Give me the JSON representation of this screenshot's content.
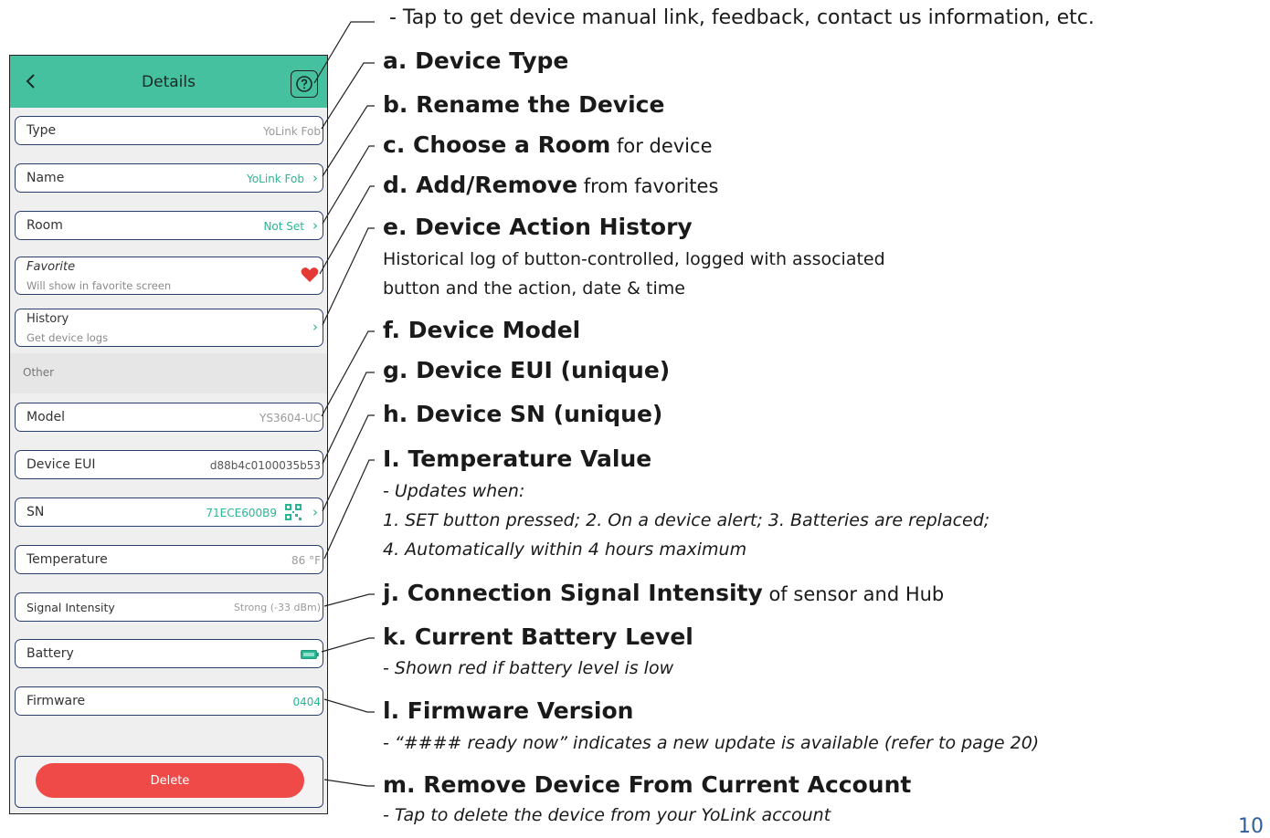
{
  "app": {
    "header_title": "Details",
    "header_color": "#45c1a0",
    "back_icon": "chevron-left-icon",
    "help_icon": "question-circle-icon",
    "rows": {
      "type": {
        "label": "Type",
        "value": "YoLink Fob"
      },
      "name": {
        "label": "Name",
        "value": "YoLink Fob"
      },
      "room": {
        "label": "Room",
        "value": "Not Set"
      },
      "favorite": {
        "label": "Favorite",
        "sub": "Will show in favorite screen"
      },
      "history": {
        "label": "History",
        "sub": "Get device logs"
      },
      "model": {
        "label": "Model",
        "value": "YS3604-UC"
      },
      "eui": {
        "label": "Device EUI",
        "value": "d88b4c0100035b53"
      },
      "sn": {
        "label": "SN",
        "value": "71ECE600B9"
      },
      "temperature": {
        "label": "Temperature",
        "value": "86 °F"
      },
      "signal": {
        "label": "Signal Intensity",
        "value": "Strong (-33 dBm)"
      },
      "battery": {
        "label": "Battery"
      },
      "firmware": {
        "label": "Firmware",
        "value": "0404"
      }
    },
    "section_other": "Other",
    "delete_label": "Delete",
    "accent_color": "#2bb594",
    "delete_color": "#ef4a48",
    "favorite_color": "#e53935"
  },
  "annotations": {
    "help": "- Tap to get device manual link, feedback, contact us information, etc.",
    "a": "a. Device Type",
    "b": "b. Rename the Device",
    "c_bold": "c. Choose a Room",
    "c_rest": " for device",
    "d_bold": "d. Add/Remove",
    "d_rest": " from favorites",
    "e": "e. Device Action History",
    "e_line1": "Historical log of button-controlled, logged with associated",
    "e_line2": "button and the action, date & time",
    "f": "f. Device Model",
    "g": "g. Device EUI (unique)",
    "h": "h. Device SN (unique)",
    "i": "I. Temperature Value",
    "i_line1": "- Updates when:",
    "i_line2": "1. SET button pressed; 2. On a device alert; 3. Batteries are replaced;",
    "i_line3": "4. Automatically within 4 hours maximum",
    "j_bold": "j. Connection Signal Intensity",
    "j_rest": " of sensor and Hub",
    "k": "k. Current Battery Level",
    "k_line1": "- Shown red if battery level is low",
    "l": "l. Firmware Version",
    "l_line1": "- “#### ready now” indicates a new update is available (refer to page 20)",
    "m": "m. Remove Device From Current Account",
    "m_line1": "- Tap to delete the device from your YoLink account"
  },
  "page_number": "10"
}
